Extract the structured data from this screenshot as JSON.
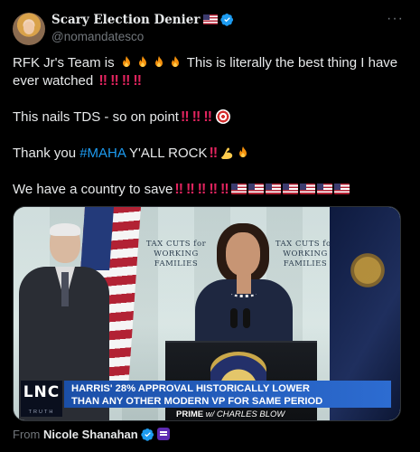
{
  "author": {
    "display_name": "Scary Election Denier",
    "handle": "@nomandatesco"
  },
  "more_label": "···",
  "tweet": {
    "line1_a": "RFK Jr's Team is",
    "line1_b": "This is literally the best thing I have",
    "line2": "ever watched",
    "line3": "This nails TDS - so on point",
    "line4_a": "Thank you",
    "hashtag": "#MAHA",
    "line4_b": "Y'ALL ROCK",
    "line5": "We have a country to save",
    "bang": "‼"
  },
  "media": {
    "banner_left": "TAX CUTS for\nWORKING FAMILIES",
    "banner_right": "TAX CUTS for\nWORKING FAMILIES",
    "logo": "LNC",
    "logo_sub": "TRUTH",
    "chyron_line1": "HARRIS' 28% APPROVAL HISTORICALLY LOWER",
    "chyron_line2": "THAN ANY OTHER MODERN VP FOR SAME PERIOD",
    "show_prefix": "PRIME",
    "show_suffix": "w/ CHARLES BLOW"
  },
  "footer": {
    "from_label": "From",
    "from_name": "Nicole Shanahan"
  },
  "colors": {
    "background": "#000000",
    "text": "#e7e9ea",
    "muted": "#71767b",
    "link": "#1d9bf0",
    "verified": "#1d9bf0"
  }
}
